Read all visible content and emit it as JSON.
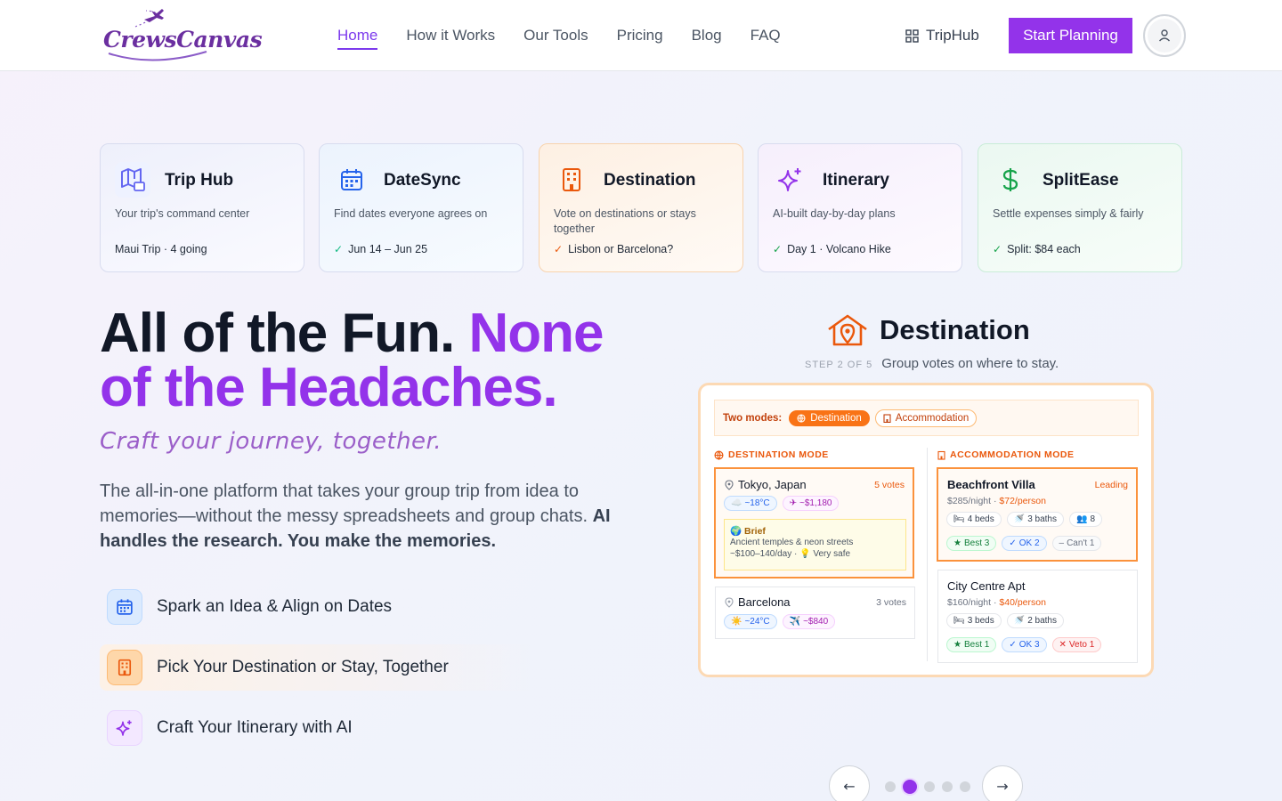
{
  "brand": {
    "name": "CrewsCanvas",
    "accent": "#9333ea"
  },
  "nav": {
    "items": [
      {
        "label": "Home",
        "active": true
      },
      {
        "label": "How it Works"
      },
      {
        "label": "Our Tools"
      },
      {
        "label": "Pricing"
      },
      {
        "label": "Blog"
      },
      {
        "label": "FAQ"
      }
    ],
    "triphub_label": "TripHub",
    "cta_label": "Start Planning"
  },
  "tools": [
    {
      "title": "Trip Hub",
      "desc": "Your trip's command center",
      "foot": "Maui Trip · 4 going",
      "icon": "map-ticket-icon",
      "color": "#6366f1"
    },
    {
      "title": "DateSync",
      "desc": "Find dates everyone agrees on",
      "foot": "Jun 14 – Jun 25",
      "icon": "calendar-icon",
      "color": "#2563eb"
    },
    {
      "title": "Destination",
      "desc": "Vote on destinations or stays together",
      "foot": "Lisbon or Barcelona?",
      "icon": "building-icon",
      "color": "#ea580c"
    },
    {
      "title": "Itinerary",
      "desc": "AI-built day-by-day plans",
      "foot": "Day 1 · Volcano Hike",
      "icon": "sparkles-icon",
      "color": "#9333ea"
    },
    {
      "title": "SplitEase",
      "desc": "Settle expenses simply & fairly",
      "foot": "Split: $84 each",
      "icon": "dollar-icon",
      "color": "#16a34a"
    }
  ],
  "hero": {
    "title_dark": "All of the Fun. ",
    "title_purple": "None of the Headaches.",
    "tagline": "Craft your journey, together.",
    "desc_plain": "The all-in-one platform that takes your group trip from idea to memories—without the messy spreadsheets and group chats. ",
    "desc_bold": "AI handles the research. You make the memories.",
    "features": [
      {
        "label": "Spark an Idea & Align on Dates",
        "icon": "calendar-icon"
      },
      {
        "label": "Pick Your Destination or Stay, Together",
        "icon": "building-icon"
      },
      {
        "label": "Craft Your Itinerary with AI",
        "icon": "sparkles-icon"
      }
    ]
  },
  "step": {
    "title": "Destination",
    "label": "STEP 2 OF 5",
    "subtitle": "Group votes on where to stay.",
    "modes_label": "Two modes:",
    "mode_destination": "Destination",
    "mode_accommodation": "Accommodation",
    "col_destination": "DESTINATION MODE",
    "col_accommodation": "ACCOMMODATION MODE",
    "destinations": [
      {
        "name": "Tokyo, Japan",
        "votes": "5 votes",
        "weather": "~18°C",
        "flight": "~$1,180",
        "brief_title": "Brief",
        "brief_line1": "Ancient temples & neon streets",
        "brief_line2": "~$100–140/day · 💡 Very safe"
      },
      {
        "name": "Barcelona",
        "votes": "3 votes",
        "weather": "~24°C",
        "flight": "~$840"
      }
    ],
    "stays": [
      {
        "name": "Beachfront Villa",
        "status": "Leading",
        "night": "$285/night · ",
        "person": "$72/person",
        "beds": "4 beds",
        "baths": "3 baths",
        "guests": "8",
        "v1": "Best 3",
        "v2": "OK 2",
        "v3": "Can't 1"
      },
      {
        "name": "City Centre Apt",
        "night": "$160/night · ",
        "person": "$40/person",
        "beds": "3 beds",
        "baths": "2 baths",
        "v1": "Best 1",
        "v2": "OK 3",
        "v3": "Veto 1"
      }
    ]
  },
  "carousel": {
    "prev": "←",
    "next": "→",
    "total": 5,
    "active": 2
  }
}
